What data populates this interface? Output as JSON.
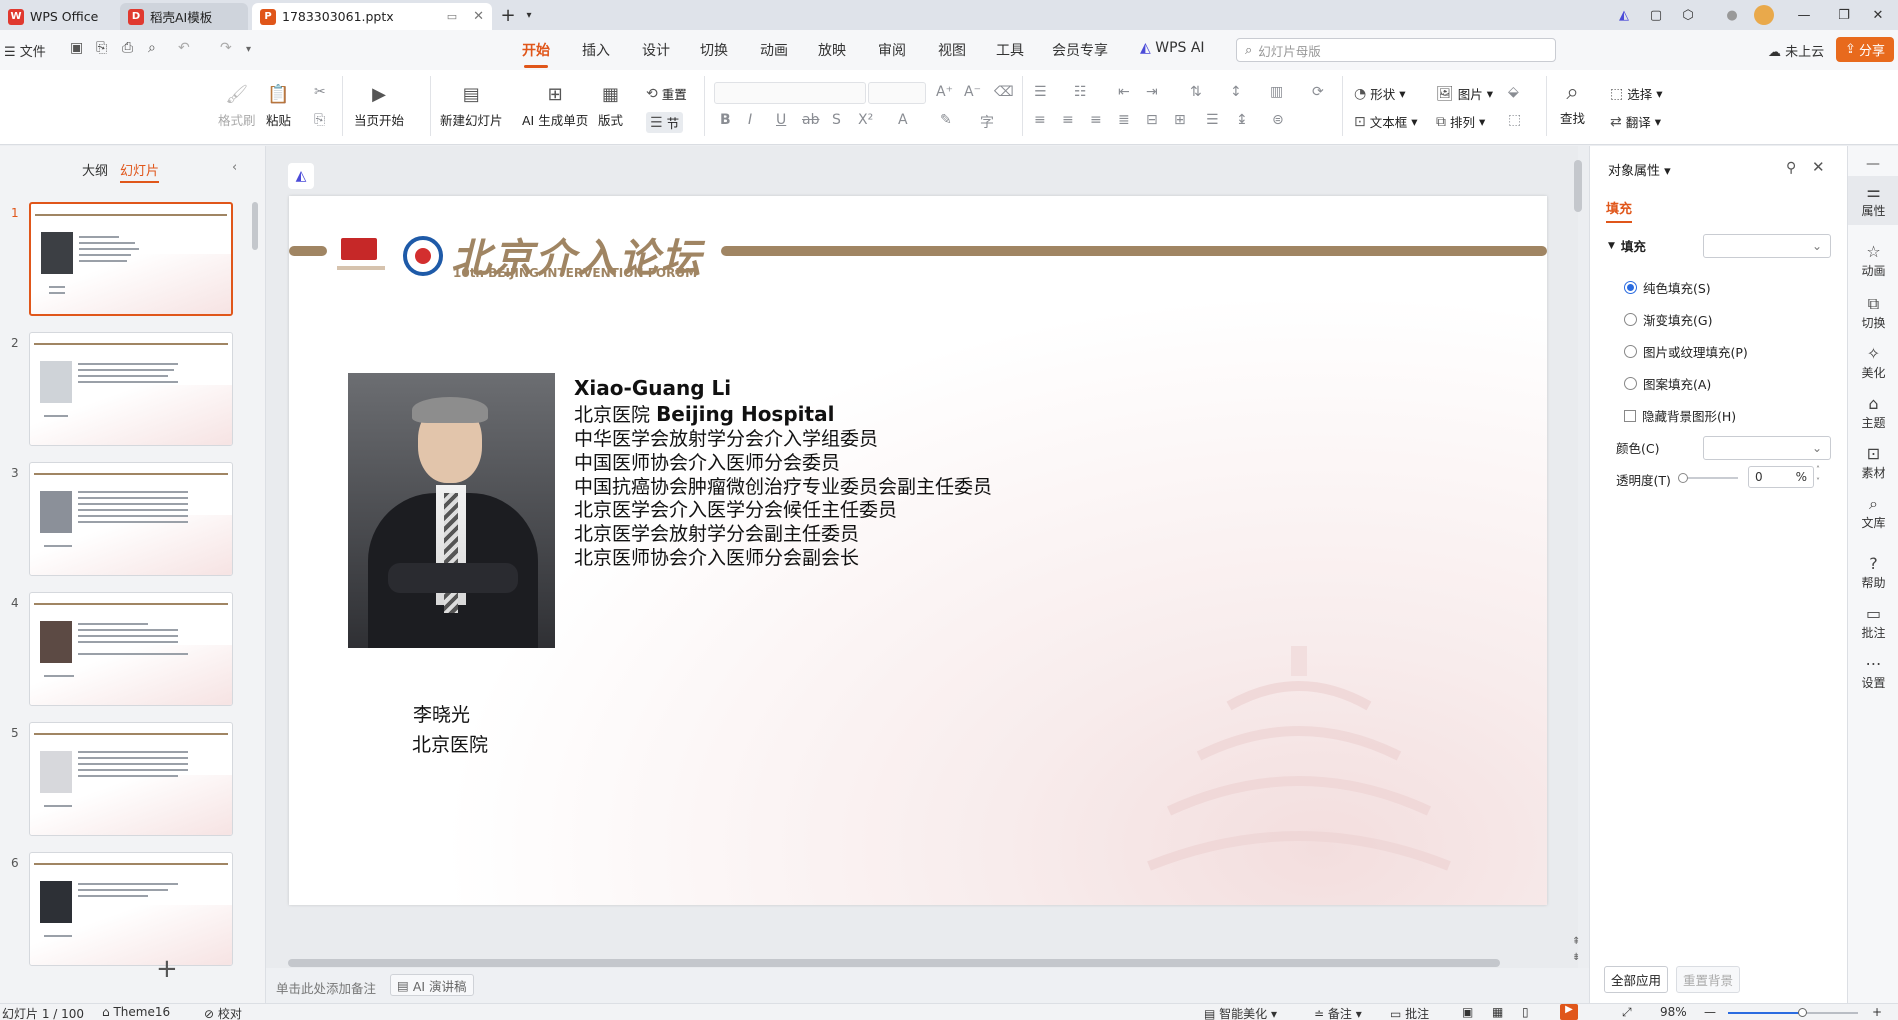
{
  "titlebar": {
    "tabs": [
      {
        "label": "WPS Office"
      },
      {
        "label": "稻壳AI模板"
      },
      {
        "label": "1783303061.pptx"
      }
    ]
  },
  "menubar": {
    "file_label": "文件",
    "tabs": [
      "开始",
      "插入",
      "设计",
      "切换",
      "动画",
      "放映",
      "审阅",
      "视图",
      "工具",
      "会员专享",
      "WPS AI"
    ],
    "search_placeholder": "幻灯片母版",
    "cloud_label": "未上云",
    "share_label": "分享"
  },
  "ribbon": {
    "format_painter": "格式刷",
    "paste": "粘贴",
    "from_current": "当页开始",
    "new_slide": "新建幻灯片",
    "ai_generate": "AI 生成单页",
    "layout": "版式",
    "reset": "重置",
    "section": "节",
    "shape": "形状",
    "picture": "图片",
    "textbox": "文本框",
    "arrange": "排列",
    "find": "查找",
    "select": "选择",
    "translate": "翻译"
  },
  "leftpanel": {
    "tab_outline": "大纲",
    "tab_slides": "幻灯片",
    "slide_numbers": [
      "1",
      "2",
      "3",
      "4",
      "5",
      "6"
    ]
  },
  "slide": {
    "forum_name": "北京介入论坛",
    "forum_sub": "10th BEIJING INTERVENTION FORUM",
    "name_en": "Xiao-Guang Li",
    "hospital_cn": "北京医院",
    "hospital_en": "Beijing Hospital",
    "roles": [
      "中华医学会放射学分会介入学组委员",
      "中国医师协会介入医师分会委员",
      "中国抗癌协会肿瘤微创治疗专业委员会副主任委员",
      "北京医学会介入医学分会候任主任委员",
      "北京医学会放射学分会副主任委员",
      "北京医师协会介入医师分会副会长"
    ],
    "caption_name": "李晓光",
    "caption_hospital": "北京医院"
  },
  "notes": {
    "placeholder": "单击此处添加备注",
    "ai_button": "AI 演讲稿"
  },
  "rightpanel": {
    "title": "对象属性",
    "tab_fill": "填充",
    "section_fill": "填充",
    "options": [
      "纯色填充(S)",
      "渐变填充(G)",
      "图片或纹理填充(P)",
      "图案填充(A)"
    ],
    "hide_bg": "隐藏背景图形(H)",
    "color_label": "颜色(C)",
    "transparency_label": "透明度(T)",
    "transparency_value": "0",
    "percent": "%",
    "apply_all": "全部应用",
    "reset_bg": "重置背景"
  },
  "sidebar": {
    "items": [
      "属性",
      "动画",
      "切换",
      "美化",
      "主题",
      "素材",
      "文库",
      "帮助",
      "批注",
      "设置"
    ]
  },
  "statusbar": {
    "slide_info": "幻灯片 1 / 100",
    "theme": "Theme16",
    "proof": "校对",
    "beautify": "智能美化",
    "notes": "备注",
    "comments": "批注",
    "zoom": "98%"
  },
  "colors": {
    "accent": "#e0561a",
    "forum_gold": "#a08563"
  }
}
